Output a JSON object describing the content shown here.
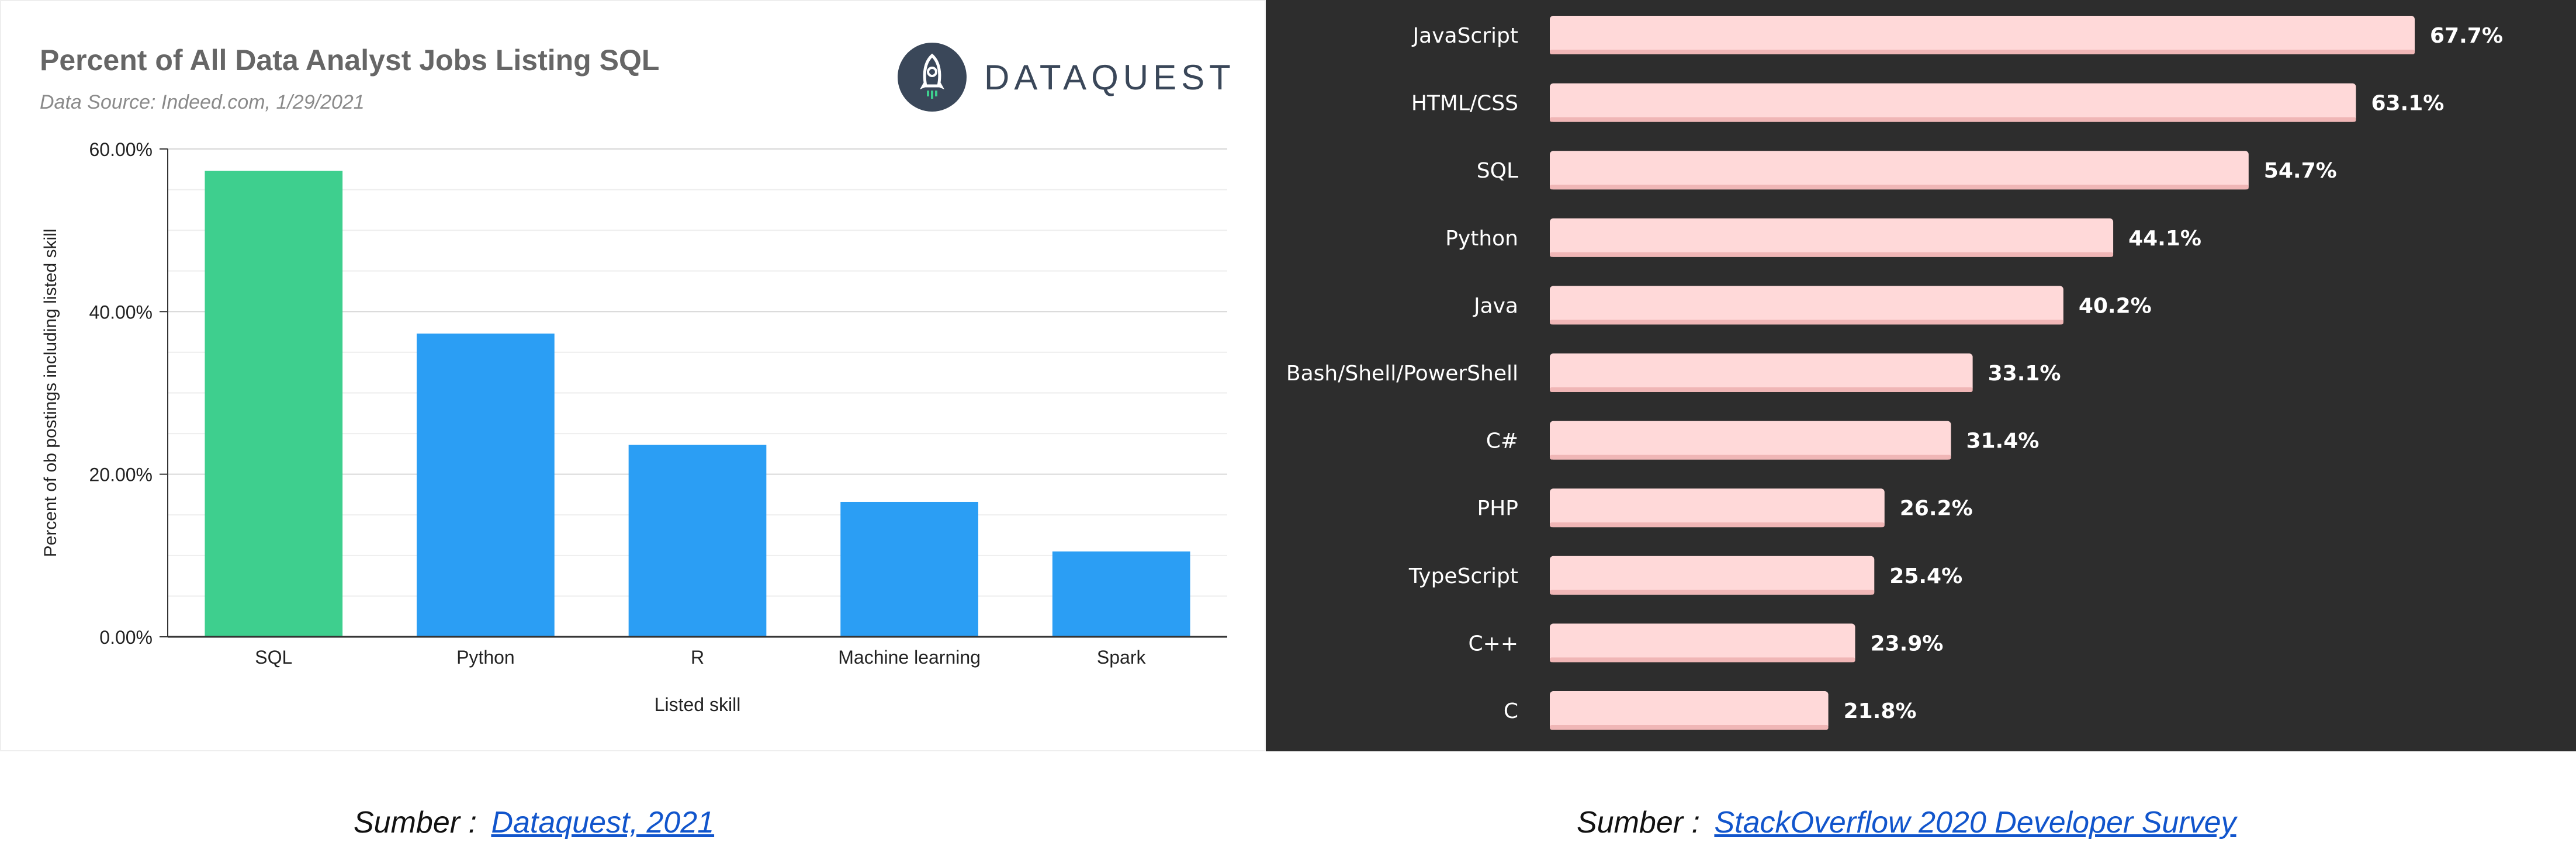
{
  "left_chart": {
    "logo_text": "DATAQUEST",
    "logo_icon": "rocket-icon",
    "source_caption": {
      "prefix": "Sumber :",
      "link": "Dataquest, 2021"
    }
  },
  "right_chart": {
    "source_caption": {
      "prefix": "Sumber :",
      "link": "StackOverflow 2020 Developer Survey"
    }
  },
  "colors": {
    "sql_bar": "#3ecf8e",
    "other_bar": "#2b9ef4",
    "right_bg": "#2d2d2d",
    "right_bar": "#ffd9d9"
  },
  "chart_data": [
    {
      "type": "bar",
      "title": "Percent of All Data Analyst Jobs Listing SQL",
      "subtitle": "Data Source: Indeed.com, 1/29/2021",
      "xlabel": "Listed skill",
      "ylabel": "Percent of ob postings including listed skill",
      "categories": [
        "SQL",
        "Python",
        "R",
        "Machine learning",
        "Spark"
      ],
      "values": [
        57.3,
        37.3,
        23.6,
        16.6,
        10.5
      ],
      "ylim": [
        0,
        60
      ],
      "yticks": [
        0,
        20,
        40,
        60
      ],
      "ytick_labels": [
        "0.00%",
        "20.00%",
        "40.00%",
        "60.00%"
      ],
      "grid": true
    },
    {
      "type": "bar",
      "orientation": "horizontal",
      "categories": [
        "JavaScript",
        "HTML/CSS",
        "SQL",
        "Python",
        "Java",
        "Bash/Shell/PowerShell",
        "C#",
        "PHP",
        "TypeScript",
        "C++",
        "C"
      ],
      "values": [
        67.7,
        63.1,
        54.7,
        44.1,
        40.2,
        33.1,
        31.4,
        26.2,
        25.4,
        23.9,
        21.8
      ],
      "value_labels": [
        "67.7%",
        "63.1%",
        "54.7%",
        "44.1%",
        "40.2%",
        "33.1%",
        "31.4%",
        "26.2%",
        "25.4%",
        "23.9%",
        "21.8%"
      ],
      "grid": false
    }
  ]
}
